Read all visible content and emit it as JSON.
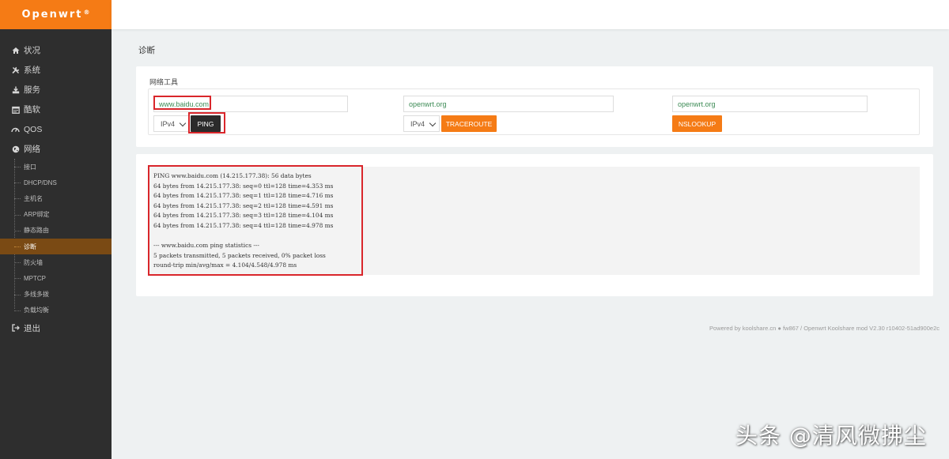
{
  "brand": {
    "name": "Openwrt",
    "mark": "®"
  },
  "sidebar": {
    "items": [
      {
        "label": "状况",
        "icon": "home-icon"
      },
      {
        "label": "系统",
        "icon": "tools-icon"
      },
      {
        "label": "服务",
        "icon": "download-tray-icon"
      },
      {
        "label": "酷软",
        "icon": "calendar-icon"
      },
      {
        "label": "QOS",
        "icon": "gauge-icon"
      },
      {
        "label": "网络",
        "icon": "globe-icon"
      }
    ],
    "network_sub": [
      {
        "label": "接口",
        "active": false
      },
      {
        "label": "DHCP/DNS",
        "active": false
      },
      {
        "label": "主机名",
        "active": false
      },
      {
        "label": "ARP绑定",
        "active": false
      },
      {
        "label": "静态路由",
        "active": false
      },
      {
        "label": "诊断",
        "active": true
      },
      {
        "label": "防火墙",
        "active": false
      },
      {
        "label": "MPTCP",
        "active": false
      },
      {
        "label": "多线多拨",
        "active": false
      },
      {
        "label": "负载均衡",
        "active": false
      }
    ],
    "logout": {
      "label": "退出",
      "icon": "logout-icon"
    }
  },
  "page_title": "诊断",
  "tools": {
    "section_label": "网络工具",
    "ping": {
      "host": "www.baidu.com",
      "protocol": "IPv4",
      "button": "PING"
    },
    "traceroute": {
      "host": "openwrt.org",
      "protocol": "IPv4",
      "button": "TRACEROUTE"
    },
    "nslookup": {
      "host": "openwrt.org",
      "button": "NSLOOKUP"
    }
  },
  "output": {
    "lines": [
      "PING www.baidu.com (14.215.177.38): 56 data bytes",
      "64 bytes from 14.215.177.38: seq=0 ttl=128 time=4.353 ms",
      "64 bytes from 14.215.177.38: seq=1 ttl=128 time=4.716 ms",
      "64 bytes from 14.215.177.38: seq=2 ttl=128 time=4.591 ms",
      "64 bytes from 14.215.177.38: seq=3 ttl=128 time=4.104 ms",
      "64 bytes from 14.215.177.38: seq=4 ttl=128 time=4.978 ms",
      "",
      "--- www.baidu.com ping statistics ---",
      "5 packets transmitted, 5 packets received, 0% packet loss",
      "round-trip min/avg/max = 4.104/4.548/4.978 ms"
    ]
  },
  "footer": "Powered by koolshare.cn ● fw867 / Openwrt Koolshare mod V2.30 r10402-51ad900e2c",
  "watermark": "头条 @清风微拂尘",
  "colors": {
    "accent": "#f57b15",
    "sidebar_bg": "#2e2e2e",
    "active_sub_bg": "#7a4a14",
    "highlight_box": "#d9262b"
  }
}
